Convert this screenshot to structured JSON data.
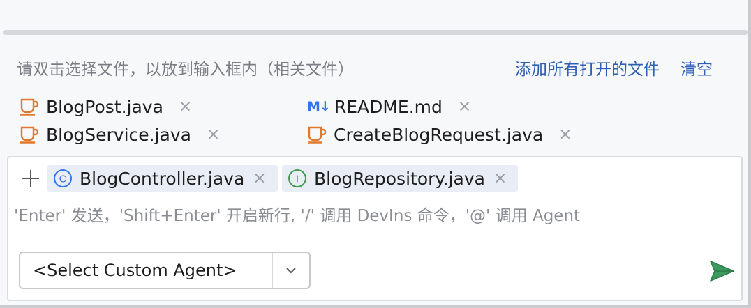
{
  "context_panel": {
    "hint": "请双击选择文件，以放到输入框内（相关文件）",
    "add_all_label": "添加所有打开的文件",
    "clear_label": "清空",
    "files": [
      {
        "name": "BlogPost.java",
        "icon": "java-coffee-icon"
      },
      {
        "name": "BlogService.java",
        "icon": "java-coffee-icon"
      },
      {
        "name": "README.md",
        "icon": "markdown-icon",
        "badge": "M↓"
      },
      {
        "name": "CreateBlogRequest.java",
        "icon": "java-coffee-icon"
      }
    ],
    "close_glyph": "×"
  },
  "input": {
    "add_glyph": "+",
    "chips": [
      {
        "name": "BlogController.java",
        "icon": "class-icon",
        "letter": "C"
      },
      {
        "name": "BlogRepository.java",
        "icon": "interface-icon",
        "letter": "I"
      }
    ],
    "placeholder": "'Enter' 发送，'Shift+Enter' 开启新行, '/' 调用 DevIns 命令，'@' 调用 Agent"
  },
  "agent_select": {
    "value": "<Select Custom Agent>"
  },
  "colors": {
    "java_icon": "#e2782e",
    "link": "#2f5fb5",
    "class_icon": "#3574f0",
    "interface_icon": "#3d9b4a",
    "send_icon": "#3c9a5f"
  }
}
